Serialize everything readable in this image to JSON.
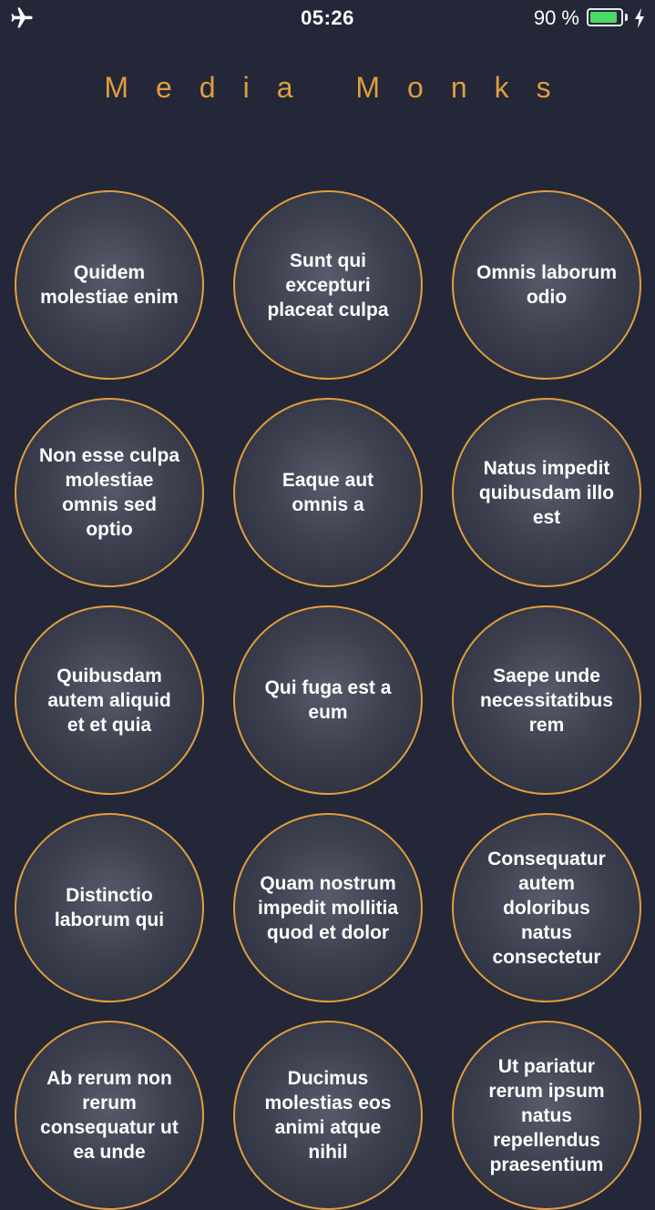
{
  "status_bar": {
    "time": "05:26",
    "battery_percent": "90 %",
    "battery_level": 0.9,
    "battery_color": "#4cd964",
    "icons": [
      "airplane-icon",
      "battery-icon",
      "charging-bolt-icon"
    ]
  },
  "header": {
    "title": "Media Monks",
    "title_color": "#e09d3e"
  },
  "colors": {
    "background": "#232738",
    "accent": "#e09d3e"
  },
  "items": [
    {
      "label": "Quidem molestiae enim"
    },
    {
      "label": "Sunt qui excepturi placeat culpa"
    },
    {
      "label": "Omnis laborum odio"
    },
    {
      "label": "Non esse culpa molestiae omnis sed optio"
    },
    {
      "label": "Eaque aut omnis a"
    },
    {
      "label": "Natus impedit quibusdam illo est"
    },
    {
      "label": "Quibusdam autem aliquid et et quia"
    },
    {
      "label": "Qui fuga est a eum"
    },
    {
      "label": "Saepe unde necessitatibus rem"
    },
    {
      "label": "Distinctio laborum qui"
    },
    {
      "label": "Quam nostrum impedit mollitia quod et dolor"
    },
    {
      "label": "Consequatur autem doloribus natus consectetur"
    },
    {
      "label": "Ab rerum non rerum consequatur ut ea unde"
    },
    {
      "label": "Ducimus molestias eos animi atque nihil"
    },
    {
      "label": "Ut pariatur rerum ipsum natus repellendus praesentium"
    }
  ]
}
